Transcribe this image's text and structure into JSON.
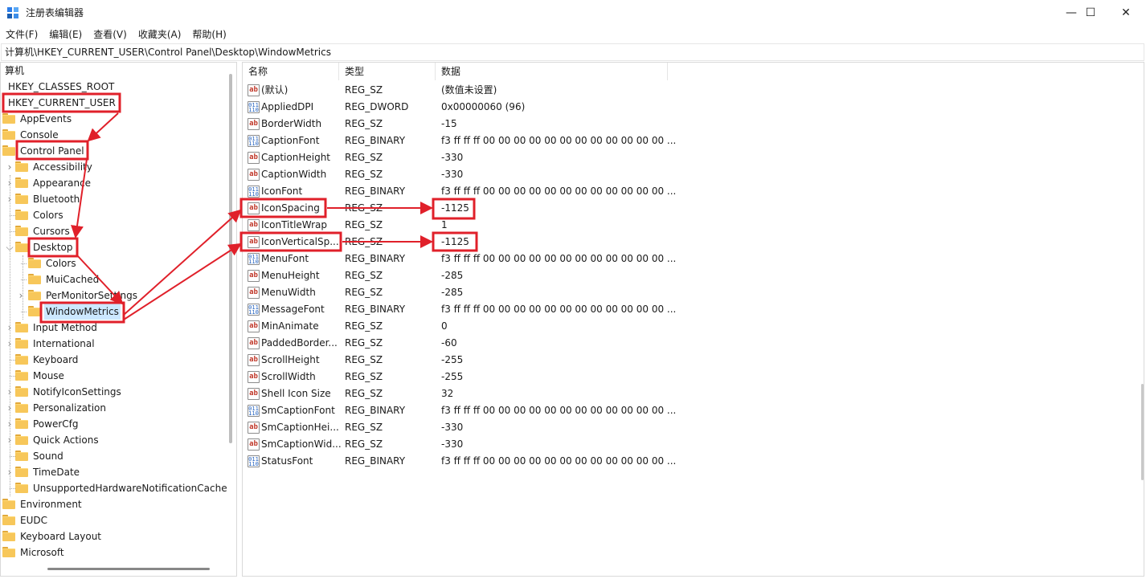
{
  "window": {
    "title": "注册表编辑器",
    "minimize_glyph": "—",
    "maximize_glyph": "☐",
    "close_glyph": "✕"
  },
  "menu": [
    "文件(F)",
    "编辑(E)",
    "查看(V)",
    "收藏夹(A)",
    "帮助(H)"
  ],
  "address": "计算机\\HKEY_CURRENT_USER\\Control Panel\\Desktop\\WindowMetrics",
  "tree": {
    "root": "算机",
    "items": [
      {
        "label": "HKEY_CLASSES_ROOT",
        "level": 0,
        "folder": false,
        "chevron": "",
        "highlight": false,
        "selected": false
      },
      {
        "label": "HKEY_CURRENT_USER",
        "level": 0,
        "folder": false,
        "chevron": "",
        "highlight": true,
        "selected": false
      },
      {
        "label": "AppEvents",
        "level": 1,
        "folder": true,
        "chevron": "",
        "highlight": false,
        "selected": false
      },
      {
        "label": "Console",
        "level": 1,
        "folder": true,
        "chevron": "",
        "highlight": false,
        "selected": false
      },
      {
        "label": "Control Panel",
        "level": 1,
        "folder": true,
        "chevron": "",
        "highlight": true,
        "selected": false
      },
      {
        "label": "Accessibility",
        "level": 2,
        "folder": true,
        "chevron": ">",
        "highlight": false,
        "selected": false
      },
      {
        "label": "Appearance",
        "level": 2,
        "folder": true,
        "chevron": ">",
        "highlight": false,
        "selected": false
      },
      {
        "label": "Bluetooth",
        "level": 2,
        "folder": true,
        "chevron": ">",
        "highlight": false,
        "selected": false
      },
      {
        "label": "Colors",
        "level": 2,
        "folder": true,
        "chevron": "",
        "highlight": false,
        "selected": false
      },
      {
        "label": "Cursors",
        "level": 2,
        "folder": true,
        "chevron": "",
        "highlight": false,
        "selected": false
      },
      {
        "label": "Desktop",
        "level": 2,
        "folder": true,
        "chevron": "v",
        "highlight": true,
        "selected": false
      },
      {
        "label": "Colors",
        "level": 3,
        "folder": true,
        "chevron": "",
        "highlight": false,
        "selected": false
      },
      {
        "label": "MuiCached",
        "level": 3,
        "folder": true,
        "chevron": "",
        "highlight": false,
        "selected": false
      },
      {
        "label": "PerMonitorSettings",
        "level": 3,
        "folder": true,
        "chevron": ">",
        "highlight": false,
        "selected": false
      },
      {
        "label": "WindowMetrics",
        "level": 3,
        "folder": true,
        "chevron": "",
        "highlight": true,
        "selected": true
      },
      {
        "label": "Input Method",
        "level": 2,
        "folder": true,
        "chevron": ">",
        "highlight": false,
        "selected": false
      },
      {
        "label": "International",
        "level": 2,
        "folder": true,
        "chevron": ">",
        "highlight": false,
        "selected": false
      },
      {
        "label": "Keyboard",
        "level": 2,
        "folder": true,
        "chevron": "",
        "highlight": false,
        "selected": false
      },
      {
        "label": "Mouse",
        "level": 2,
        "folder": true,
        "chevron": "",
        "highlight": false,
        "selected": false
      },
      {
        "label": "NotifyIconSettings",
        "level": 2,
        "folder": true,
        "chevron": ">",
        "highlight": false,
        "selected": false
      },
      {
        "label": "Personalization",
        "level": 2,
        "folder": true,
        "chevron": ">",
        "highlight": false,
        "selected": false
      },
      {
        "label": "PowerCfg",
        "level": 2,
        "folder": true,
        "chevron": ">",
        "highlight": false,
        "selected": false
      },
      {
        "label": "Quick Actions",
        "level": 2,
        "folder": true,
        "chevron": ">",
        "highlight": false,
        "selected": false
      },
      {
        "label": "Sound",
        "level": 2,
        "folder": true,
        "chevron": "",
        "highlight": false,
        "selected": false
      },
      {
        "label": "TimeDate",
        "level": 2,
        "folder": true,
        "chevron": ">",
        "highlight": false,
        "selected": false
      },
      {
        "label": "UnsupportedHardwareNotificationCache",
        "level": 2,
        "folder": true,
        "chevron": "",
        "highlight": false,
        "selected": false
      },
      {
        "label": "Environment",
        "level": 1,
        "folder": true,
        "chevron": "",
        "highlight": false,
        "selected": false
      },
      {
        "label": "EUDC",
        "level": 1,
        "folder": true,
        "chevron": "",
        "highlight": false,
        "selected": false
      },
      {
        "label": "Keyboard Layout",
        "level": 1,
        "folder": true,
        "chevron": "",
        "highlight": false,
        "selected": false
      },
      {
        "label": "Microsoft",
        "level": 1,
        "folder": true,
        "chevron": "",
        "highlight": false,
        "selected": false
      }
    ]
  },
  "list": {
    "headers": {
      "name": "名称",
      "type": "类型",
      "data": "数据"
    },
    "rows": [
      {
        "icon": "sz",
        "name": "(默认)",
        "type": "REG_SZ",
        "data": "(数值未设置)",
        "highlight": false
      },
      {
        "icon": "bin",
        "name": "AppliedDPI",
        "type": "REG_DWORD",
        "data": "0x00000060 (96)",
        "highlight": false
      },
      {
        "icon": "sz",
        "name": "BorderWidth",
        "type": "REG_SZ",
        "data": "-15",
        "highlight": false
      },
      {
        "icon": "bin",
        "name": "CaptionFont",
        "type": "REG_BINARY",
        "data": "f3 ff ff ff 00 00 00 00 00 00 00 00 00 00 00 00 ...",
        "highlight": false
      },
      {
        "icon": "sz",
        "name": "CaptionHeight",
        "type": "REG_SZ",
        "data": "-330",
        "highlight": false
      },
      {
        "icon": "sz",
        "name": "CaptionWidth",
        "type": "REG_SZ",
        "data": "-330",
        "highlight": false
      },
      {
        "icon": "bin",
        "name": "IconFont",
        "type": "REG_BINARY",
        "data": "f3 ff ff ff 00 00 00 00 00 00 00 00 00 00 00 00 ...",
        "highlight": false
      },
      {
        "icon": "sz",
        "name": "IconSpacing",
        "type": "REG_SZ",
        "data": "-1125",
        "highlight": true
      },
      {
        "icon": "sz",
        "name": "IconTitleWrap",
        "type": "REG_SZ",
        "data": "1",
        "highlight": false
      },
      {
        "icon": "sz",
        "name": "IconVerticalSp...",
        "type": "REG_SZ",
        "data": "-1125",
        "highlight": true
      },
      {
        "icon": "bin",
        "name": "MenuFont",
        "type": "REG_BINARY",
        "data": "f3 ff ff ff 00 00 00 00 00 00 00 00 00 00 00 00 ...",
        "highlight": false
      },
      {
        "icon": "sz",
        "name": "MenuHeight",
        "type": "REG_SZ",
        "data": "-285",
        "highlight": false
      },
      {
        "icon": "sz",
        "name": "MenuWidth",
        "type": "REG_SZ",
        "data": "-285",
        "highlight": false
      },
      {
        "icon": "bin",
        "name": "MessageFont",
        "type": "REG_BINARY",
        "data": "f3 ff ff ff 00 00 00 00 00 00 00 00 00 00 00 00 ...",
        "highlight": false
      },
      {
        "icon": "sz",
        "name": "MinAnimate",
        "type": "REG_SZ",
        "data": "0",
        "highlight": false
      },
      {
        "icon": "sz",
        "name": "PaddedBorder...",
        "type": "REG_SZ",
        "data": "-60",
        "highlight": false
      },
      {
        "icon": "sz",
        "name": "ScrollHeight",
        "type": "REG_SZ",
        "data": "-255",
        "highlight": false
      },
      {
        "icon": "sz",
        "name": "ScrollWidth",
        "type": "REG_SZ",
        "data": "-255",
        "highlight": false
      },
      {
        "icon": "sz",
        "name": "Shell Icon Size",
        "type": "REG_SZ",
        "data": "32",
        "highlight": false
      },
      {
        "icon": "bin",
        "name": "SmCaptionFont",
        "type": "REG_BINARY",
        "data": "f3 ff ff ff 00 00 00 00 00 00 00 00 00 00 00 00 ...",
        "highlight": false
      },
      {
        "icon": "sz",
        "name": "SmCaptionHei...",
        "type": "REG_SZ",
        "data": "-330",
        "highlight": false
      },
      {
        "icon": "sz",
        "name": "SmCaptionWid...",
        "type": "REG_SZ",
        "data": "-330",
        "highlight": false
      },
      {
        "icon": "bin",
        "name": "StatusFont",
        "type": "REG_BINARY",
        "data": "f3 ff ff ff 00 00 00 00 00 00 00 00 00 00 00 00 ...",
        "highlight": false
      }
    ]
  },
  "icons": {
    "sz": "ab",
    "bin": "011 110"
  },
  "colors": {
    "annotation": "#e0202a",
    "selection": "#cce8ff",
    "folder": "#f7c75a"
  }
}
